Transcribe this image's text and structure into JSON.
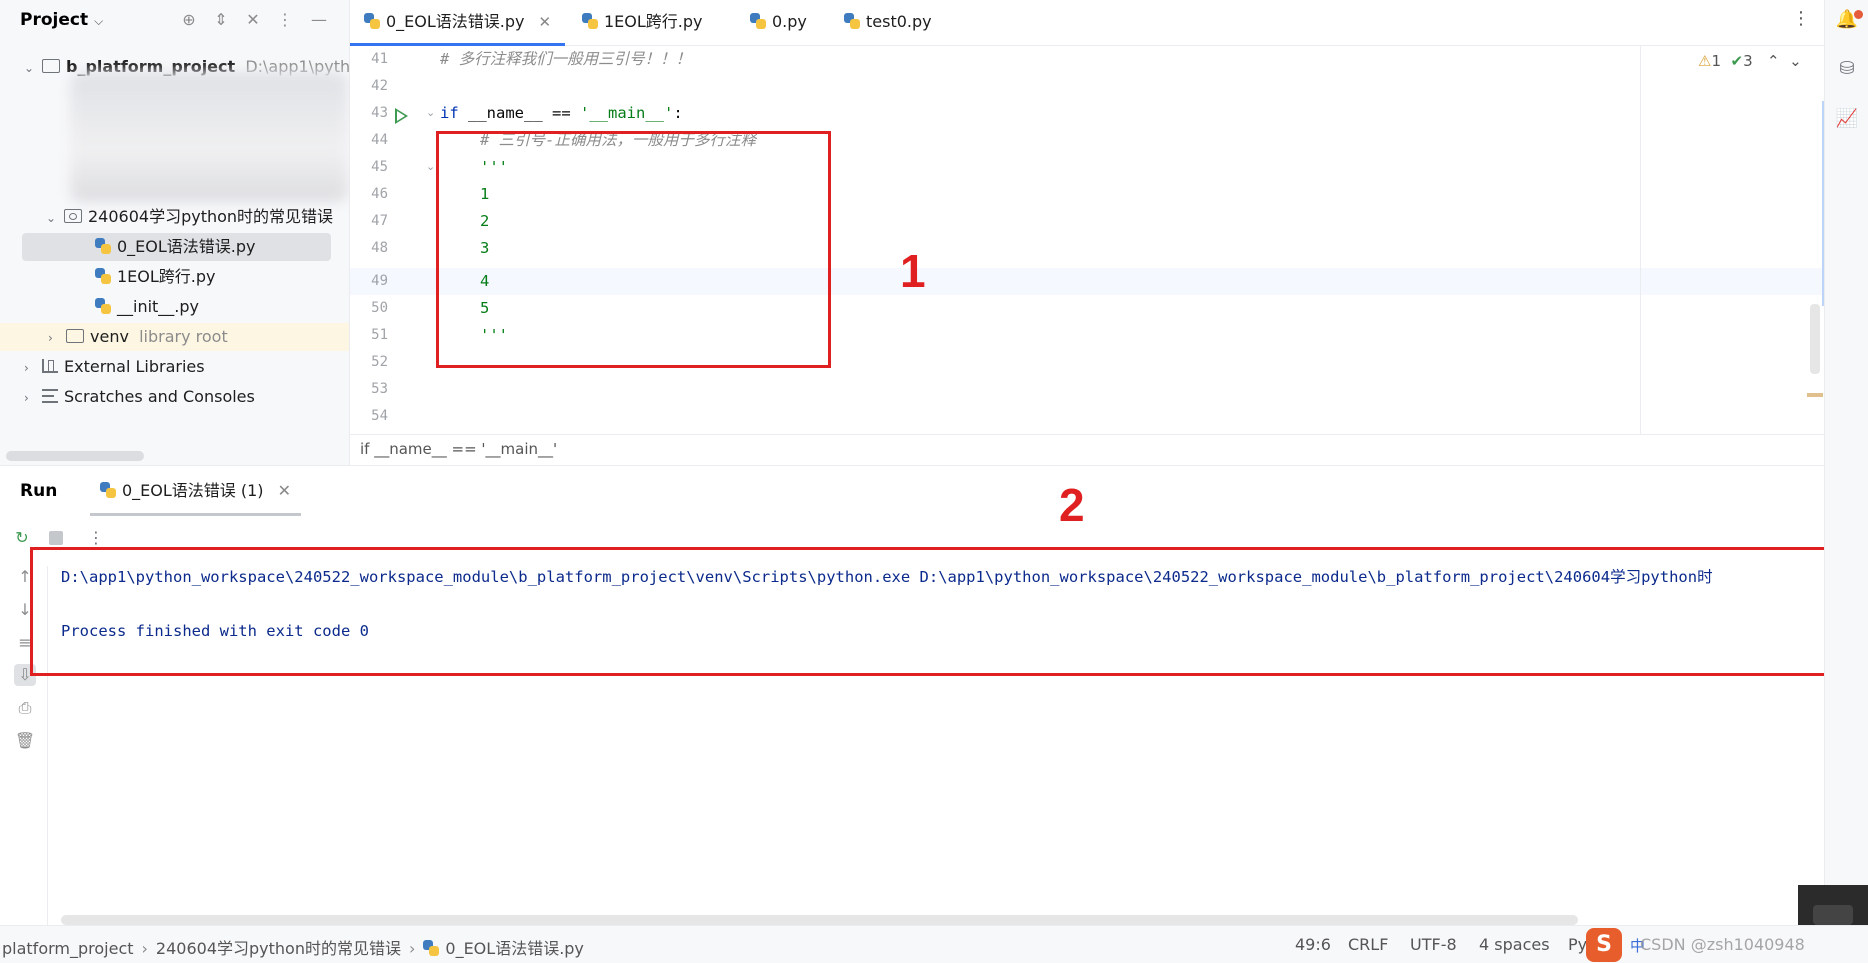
{
  "project_panel": {
    "title": "Project",
    "root": {
      "name": "b_platform_project",
      "path": "D:\\app1\\pytho"
    },
    "folder": "240604学习python时的常见错误",
    "files": [
      "0_EOL语法错误.py",
      "1EOL跨行.py",
      "__init__.py"
    ],
    "venv": {
      "name": "venv",
      "hint": "library root"
    },
    "external_libraries": "External Libraries",
    "scratches": "Scratches and Consoles"
  },
  "tabs": [
    {
      "label": "0_EOL语法错误.py",
      "active": true
    },
    {
      "label": "1EOL跨行.py",
      "active": false
    },
    {
      "label": "0.py",
      "active": false
    },
    {
      "label": "test0.py",
      "active": false
    }
  ],
  "editor": {
    "line_numbers": [
      "41",
      "42",
      "43",
      "44",
      "45",
      "46",
      "47",
      "48",
      "49",
      "50",
      "51",
      "52",
      "53",
      "54"
    ],
    "line41_comment": "# 多行注释我们一般用三引号！！！",
    "line43_kw": "if",
    "line43_name": " __name__ == ",
    "line43_str": "'__main__'",
    "line43_colon": ":",
    "line44_comment": "# 三引号-正确用法，一般用于多行注释",
    "triple_quote": "'''",
    "digits": [
      "1",
      "2",
      "3",
      "4",
      "5"
    ],
    "inspections": {
      "warnings": "1",
      "checks": "3"
    },
    "breadcrumb": "if __name__ == '__main__'"
  },
  "annotations": {
    "box1": "1",
    "box2": "2"
  },
  "run_panel": {
    "label": "Run",
    "tab_label": "0_EOL语法错误 (1)",
    "console_lines": [
      "D:\\app1\\python_workspace\\240522_workspace_module\\b_platform_project\\venv\\Scripts\\python.exe D:\\app1\\python_workspace\\240522_workspace_module\\b_platform_project\\240604学习python时",
      "",
      "Process finished with exit code 0"
    ]
  },
  "status_bar": {
    "path": [
      "platform_project",
      "240604学习python时的常见错误",
      "0_EOL语法错误.py"
    ],
    "position": "49:6",
    "line_sep": "CRLF",
    "encoding": "UTF-8",
    "indent": "4 spaces",
    "interpreter": "Py",
    "ime": "中",
    "watermark": "CSDN @zsh1040948"
  },
  "colors": {
    "accent": "#3574f0",
    "annotation_red": "#e02020",
    "console_text": "#0b2a8c",
    "string_green": "#067d17",
    "keyword_blue": "#0033b3"
  },
  "icons": [
    "chevron-down-icon",
    "crosshair-icon",
    "expand-icon",
    "collapse-icon",
    "more-icon",
    "minimize-icon",
    "folder-icon",
    "python-file-icon",
    "run-gutter-icon",
    "rerun-icon",
    "stop-icon",
    "notification-icon",
    "database-icon",
    "chart-icon",
    "sogou-icon"
  ]
}
